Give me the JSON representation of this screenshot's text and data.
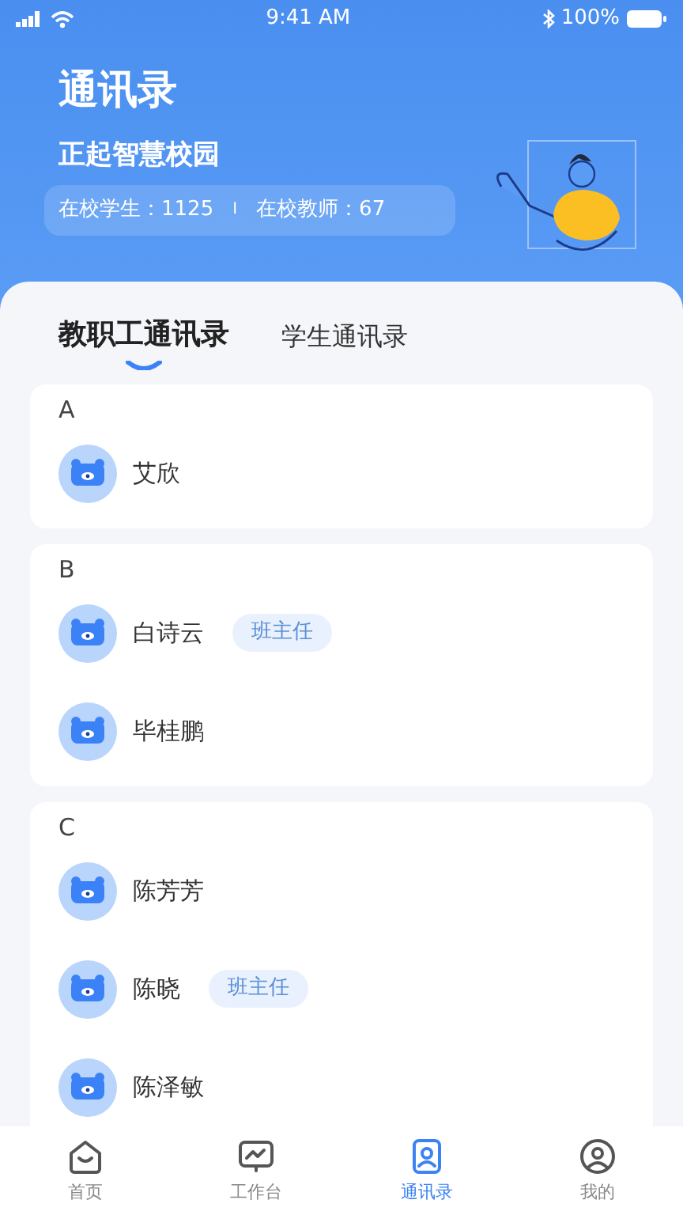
{
  "status_bar": {
    "time": "9:41 AM",
    "battery": "100%"
  },
  "header": {
    "title": "通讯录",
    "school": "正起智慧校园",
    "stats": [
      {
        "label": "在校学生：1125"
      },
      {
        "label": "在校教师：67"
      }
    ],
    "divider": "I"
  },
  "tabs": [
    {
      "label": "教职工通讯录",
      "selected": true
    },
    {
      "label": "学生通讯录",
      "selected": false
    }
  ],
  "groups": [
    {
      "letter": "A",
      "contacts": [
        {
          "name": "艾欣"
        }
      ]
    },
    {
      "letter": "B",
      "contacts": [
        {
          "name": "白诗云",
          "badge": "班主任"
        },
        {
          "name": "毕桂鹏"
        }
      ]
    },
    {
      "letter": "C",
      "contacts": [
        {
          "name": "陈芳芳"
        },
        {
          "name": "陈晓",
          "badge": "班主任"
        },
        {
          "name": "陈泽敏"
        }
      ]
    }
  ],
  "bottom_nav": [
    {
      "label": "首页",
      "kind": "home",
      "selected": false
    },
    {
      "label": "工作台",
      "kind": "work",
      "selected": false
    },
    {
      "label": "通讯录",
      "kind": "contacts",
      "selected": true
    },
    {
      "label": "我的",
      "kind": "me",
      "selected": false
    }
  ]
}
